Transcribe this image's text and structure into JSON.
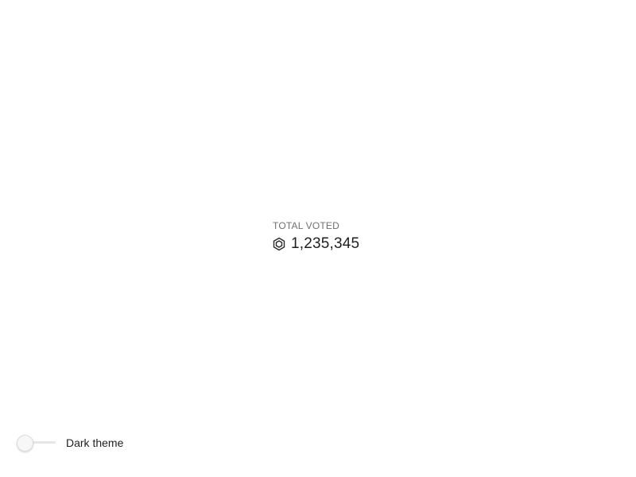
{
  "stat": {
    "label": "TOTAL VOTED",
    "value": "1,235,345",
    "icon": "hexagon-token-icon"
  },
  "theme_toggle": {
    "label": "Dark theme",
    "checked": false
  },
  "colors": {
    "background": "#ffffff",
    "text": "#1f1f1f",
    "muted_text": "#6f6f6f",
    "track": "#e6e6e6"
  }
}
